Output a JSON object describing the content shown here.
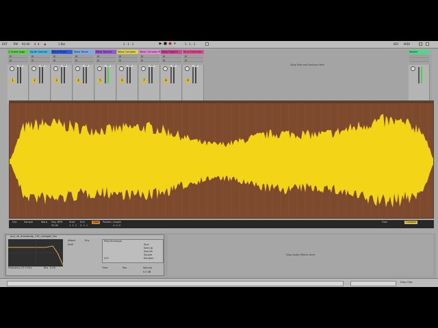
{
  "control_bar": {
    "ext_label": "EXT",
    "tap_label": "TAP",
    "tempo": "93.00",
    "meter_num": "4",
    "meter_den": "4",
    "quantize": "1 Bar",
    "position": "1 . 1 . 1",
    "loop_start": "1 . 1 . 1",
    "key_label": "KEY",
    "midi_label": "MIDI"
  },
  "tracks": [
    {
      "name": "1 Grand Lega",
      "color": "#5dcf4a",
      "number": "1",
      "volume": "-inf"
    },
    {
      "name": "Synth Sounds",
      "color": "#46b6e6",
      "number": "2",
      "volume": "-inf"
    },
    {
      "name": "Warp Modes",
      "color": "#2a5de0",
      "number": "3",
      "volume": "-inf"
    },
    {
      "name": "Warp Tones",
      "color": "#7aa8f0",
      "number": "4",
      "volume": "-inf"
    },
    {
      "name": "Warp Texture",
      "color": "#9a55d8",
      "number": "5",
      "volume": "-inf"
    },
    {
      "name": "Warp Complex",
      "color": "#e0d24a",
      "number": "6",
      "volume": "-inf"
    },
    {
      "name": "Warp Complex Pro",
      "color": "#e98ad6",
      "number": "7",
      "volume": "-inf"
    },
    {
      "name": "Warp Repitch",
      "color": "#d2419e",
      "number": "8",
      "volume": "-inf"
    },
    {
      "name": "Vinyl Distortion",
      "color": "#e44e94",
      "number": "9",
      "volume": "-inf"
    }
  ],
  "session_drop_label": "Drop Files and Devices Here",
  "master": {
    "name": "Master",
    "color": "#4fd88a"
  },
  "clip": {
    "labels": [
      "Clip",
      "Sample",
      "Warp",
      "Seg. BPM",
      "Start",
      "End",
      "Loop",
      "Position",
      "Length",
      "Gain"
    ],
    "warp_mode": "Complex",
    "sample_name": "pno_uh_maestroop_132_vintage2_Stx",
    "values": [
      "93.00",
      "1. 1. 1",
      "5. 1. 1",
      "4. 0. 0"
    ]
  },
  "device": {
    "title": "pno_uh_maestroop_132_vintage2_Stx",
    "section_attack": "Attack",
    "section_env": "Env",
    "section_shift": "Shift",
    "filter_type": "Pitch/Envelope",
    "lfo_label": "LFO",
    "frequency_label": "Frequency",
    "frequency_value": "22.0 kHz",
    "res_label": "Res",
    "res_value": "0.00",
    "pitch_options": [
      "Sine",
      "Saw Up",
      "Saw Dn",
      "Square",
      "Random"
    ],
    "output_labels": [
      "Time",
      "Pan",
      "Volume"
    ],
    "vol_value": "0.0 dB"
  },
  "drop_audio_label": "Drop Audio Effects Here",
  "status": {
    "right_label": "Drop Clips"
  },
  "waveform": {
    "color": "#f4d416",
    "background": "#7e4a2e"
  }
}
